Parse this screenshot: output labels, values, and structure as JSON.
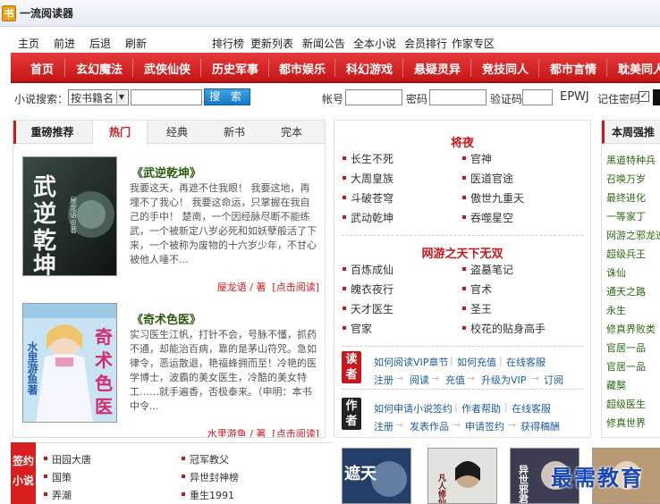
{
  "window": {
    "title": "一流阅读器"
  },
  "top_menu": [
    "主页",
    "前进",
    "后退",
    "刷新",
    "排行榜",
    "更新列表",
    "新闻公告",
    "全本小说",
    "会员排行",
    "作家专区"
  ],
  "nav": [
    "首页",
    "玄幻魔法",
    "武侠仙侠",
    "历史军事",
    "都市娱乐",
    "科幻游戏",
    "悬疑灵异",
    "竞技同人",
    "都市言情",
    "耽美同人"
  ],
  "search": {
    "label": "小说搜索：",
    "select_value": "按书籍名",
    "button": "搜 索",
    "account_label": "帐号",
    "password_label": "密码",
    "captcha_label": "验证码",
    "captcha_text": "EPWJ",
    "remember_label": "记住密码",
    "remember_checked": "✓"
  },
  "recommend": {
    "heading": "重磅推荐",
    "tabs": [
      "热门",
      "经典",
      "新书",
      "完本"
    ],
    "books": [
      {
        "title": "《武逆乾坤》",
        "cover_text": "武逆乾坤",
        "cover_author": "屋龙语◎著",
        "desc": "我要这天，再遮不住我眼！ 我要这地，再埋不了我心！ 我要这命运，只掌握在我自己的手中！ 楚南，一个因经脉尽断不能练武，一个被新定八岁必死和如妖孽般活了下来，一个被称为废物的十六岁少年，不甘心被他人唾不...",
        "author_link": "屋龙语 / 著",
        "read_link": "[点击阅读]"
      },
      {
        "title": "《奇术色医》",
        "cover_text": "奇术色医",
        "cover_author": "水里游鱼著",
        "desc": "实习医生江帆，打针不会，号脉不懂，抓药不通，却能治百病，靠的是茅山符咒。急如律令，恶运散退，艳福蜂拥而至！冷艳的医学博士，波霸的美女医生，冷酷的美女特工……就手遍香，否极泰来。（申明：本书中令...",
        "author_link": "水里游鱼 / 著",
        "read_link": "[点击阅读]"
      }
    ]
  },
  "middle": {
    "section1_title": "将夜",
    "section1_items": [
      "长生不死",
      "官神",
      "大周皇族",
      "医道官途",
      "斗破苍穹",
      "傲世九重天",
      "武动乾坤",
      "吞噬星空"
    ],
    "section2_title": "网游之天下无双",
    "section2_items": [
      "百炼成仙",
      "盗墓笔记",
      "魄衣夜行",
      "官术",
      "天才医生",
      "圣王",
      "官家",
      "校花的贴身高手"
    ],
    "reader_badge": "读者",
    "reader_links_row1": [
      "如何阅读VIP章节",
      "如何充值",
      "在线客服"
    ],
    "reader_links_row2": [
      "注册",
      "阅读",
      "充值",
      "升级为VIP",
      "订阅"
    ],
    "author_badge": "作者",
    "author_links_row1": [
      "如何申请小说签约",
      "作者帮助",
      "在线客服"
    ],
    "author_links_row2": [
      "注册",
      "发表作品",
      "申请签约",
      "获得稿酬"
    ]
  },
  "weekly": {
    "heading": "本周强推",
    "items": [
      "黑道特种兵",
      "召唤万岁",
      "最终进化",
      "一等家丁",
      "网游之邪龙逆天",
      "超级兵王",
      "诛仙",
      "通天之路",
      "永生",
      "修真界败类",
      "官居一品",
      "官居一品",
      "藏獒",
      "超级医生",
      "修真世界"
    ]
  },
  "bottom": {
    "sign_badge": "签约小说",
    "col1": [
      "田园大唐",
      "国策",
      "弄潮"
    ],
    "col2": [
      "冠军教父",
      "异世封神榜",
      "重生1991"
    ],
    "thumbs": [
      "遮天",
      "凡人修仙",
      "异世邪君",
      ""
    ]
  },
  "watermark": "最需教育",
  "colors": {
    "brand_red": "#c8161d",
    "nav_red": "#d82222",
    "link_blue": "#1d5b9e",
    "green_title": "#2a5a0c"
  }
}
